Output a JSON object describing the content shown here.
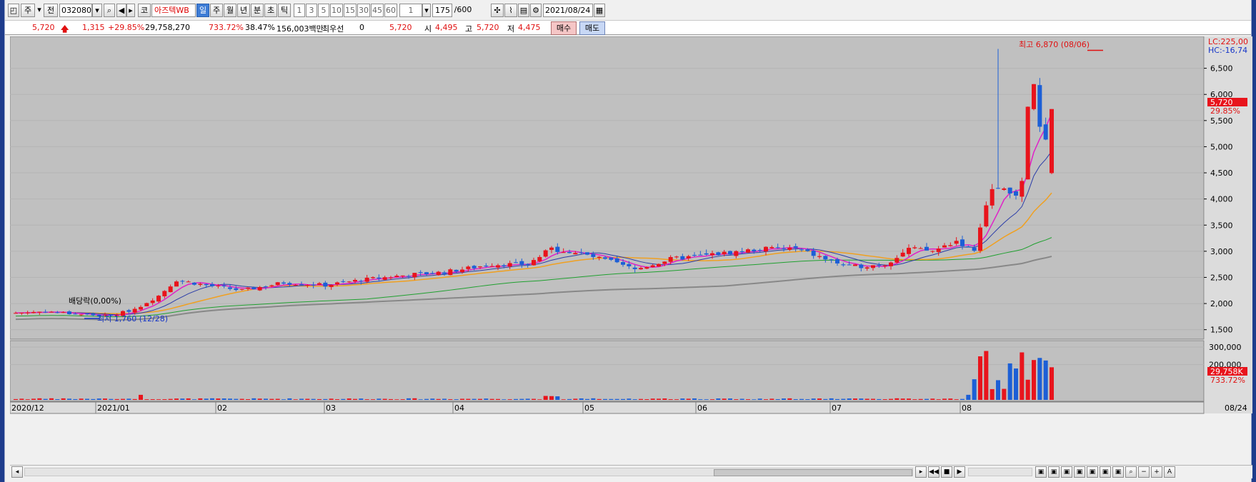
{
  "toolbar": {
    "period_btn": "주",
    "jeon_btn": "전",
    "stock_code": "032080",
    "market_btn": "코",
    "stock_name": "아즈텍WB",
    "tabs": [
      "일",
      "주",
      "월",
      "년",
      "분",
      "초",
      "틱"
    ],
    "minute_opts": [
      "1",
      "3",
      "5",
      "10",
      "15",
      "30",
      "45",
      "60"
    ],
    "interval_value": "1",
    "count_value": "175",
    "count_max": "/600",
    "date_value": "2021/08/24"
  },
  "price": {
    "current": "5,720",
    "change": "1,315",
    "change_pct": "+29.85%",
    "volume": "29,758,270",
    "volume_pct": "733.72%",
    "turnover": "38.47%",
    "amount": "156,003백만",
    "priority_label": "최우선",
    "priority_value": "0",
    "priority_price": "5,720",
    "open_label": "시",
    "open": "4,495",
    "high_label": "고",
    "high": "5,720",
    "low_label": "저",
    "low": "4,475",
    "buy_label": "매수",
    "sell_label": "매도"
  },
  "chart_labels": {
    "lc": "LC:225,00",
    "hc": "HC:-16,74",
    "high_note": "최고 6,870 (08/06)",
    "low_note": "최저 1,760 (12/28)",
    "dividend_note": "배당락(0,00%)",
    "cur_price_tag": "5,720",
    "cur_pct_tag": "29.85%",
    "vol_tag": "29,758K",
    "vol_pct_tag": "733.72%"
  },
  "chart_data": {
    "type": "candlestick",
    "price_axis": [
      "6,500",
      "6,000",
      "5,500",
      "5,000",
      "4,500",
      "4,000",
      "3,500",
      "3,000",
      "2,500",
      "2,000",
      "1,500"
    ],
    "price_ticks": [
      6500,
      6000,
      5500,
      5000,
      4500,
      4000,
      3500,
      3000,
      2500,
      2000,
      1500
    ],
    "ylim": [
      1400,
      7000
    ],
    "volume_axis": [
      "300,000",
      "200,000"
    ],
    "volume_ticks": [
      300000,
      200000
    ],
    "date_axis": [
      "2020/12",
      "2021/01",
      "02",
      "03",
      "04",
      "05",
      "06",
      "07",
      "08",
      "08/24"
    ],
    "colors": {
      "up": "#e8141c",
      "down": "#1c5fd6",
      "ma5": "#e020c8",
      "ma10": "#2a3ca8",
      "ma20": "#f0a020",
      "ma60": "#20a030",
      "ma120": "#888888",
      "bg": "#c0c0c0"
    },
    "last_close": 5720,
    "high": 6870,
    "low": 1760
  }
}
